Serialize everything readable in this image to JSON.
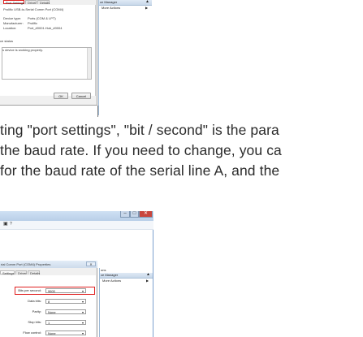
{
  "top_screenshot": {
    "tabs": [
      "Port Settings",
      "Driver",
      "Details"
    ],
    "selected_tab": "Port Settings",
    "device_name": "Prolific USB-to-Serial Comm Port (COM4)",
    "properties": [
      {
        "label": "Device type:",
        "value": "Ports (COM & LPT)"
      },
      {
        "label": "Manufacturer:",
        "value": "Prolific"
      },
      {
        "label": "Location:",
        "value": "Port_#0001.Hub_#0004"
      }
    ],
    "status_heading": "ce status",
    "status_text": "s device is working properly.",
    "ok_label": "OK",
    "cancel_label": "Cancel",
    "actions_header": "ce Manager",
    "actions_item": "More Actions"
  },
  "paragraph": {
    "line1": "ting \"port settings\", \"bit / second\" is the para",
    "line2": "the baud rate. If you need to change, you ca",
    "line3": "for the baud rate of the serial line A, and the"
  },
  "bottom_screenshot": {
    "window_title": "rial Comm Port (COM4) Properties",
    "tabs": [
      "Settings",
      "Driver",
      "Details"
    ],
    "fields": [
      {
        "label": "Bits per second:",
        "value": "9600",
        "highlighted": true
      },
      {
        "label": "Data bits:",
        "value": "8"
      },
      {
        "label": "Parity:",
        "value": "None"
      },
      {
        "label": "Stop bits:",
        "value": "1"
      },
      {
        "label": "Flow control:",
        "value": "None"
      }
    ],
    "actions_header": "ons",
    "actions_header2": "ce Manager",
    "actions_item": "More Actions",
    "window_controls": [
      "–",
      "□",
      "✕"
    ],
    "colors": {
      "highlight": "#e02020",
      "titlebar": "#b9cfe8",
      "close_button": "#c9463d"
    }
  }
}
